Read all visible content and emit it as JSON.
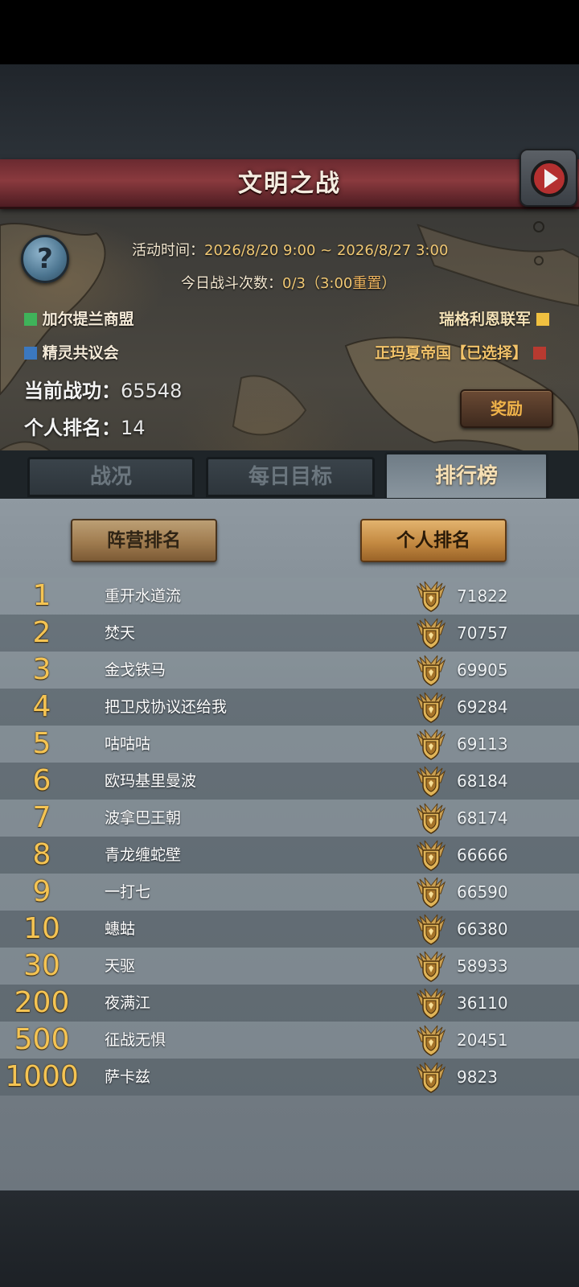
{
  "header": {
    "title": "文明之战"
  },
  "event": {
    "time_label": "活动时间：",
    "time_value": "2026/8/20 9:00 ~ 2026/8/27 3:00",
    "battles_label": "今日战斗次数：",
    "battles_value": "0/3（3:00",
    "battles_reset": "重置",
    "battles_close": "）"
  },
  "factions": {
    "left": [
      {
        "name": "加尔提兰商盟",
        "color": "#3fb35a"
      },
      {
        "name": "精灵共议会",
        "color": "#3b78c0"
      }
    ],
    "right": [
      {
        "name": "瑞格利恩联军",
        "color": "#f0c040"
      },
      {
        "name": "正玛夏帝国【已选择】",
        "color": "#b83a30"
      }
    ]
  },
  "stats": {
    "merit_label": "当前战功：",
    "merit_value": "65548",
    "rank_label": "个人排名：",
    "rank_value": "14"
  },
  "buttons": {
    "reward": "奖励"
  },
  "tabs": [
    "战况",
    "每日目标",
    "排行榜"
  ],
  "subtabs": [
    "阵营排名",
    "个人排名"
  ],
  "icons": {
    "help": "question-icon",
    "video": "play-video-icon",
    "medal": "medal-icon"
  },
  "ranking": [
    {
      "rank": "1",
      "name": "重开水道流",
      "score": "71822"
    },
    {
      "rank": "2",
      "name": "焚天",
      "score": "70757"
    },
    {
      "rank": "3",
      "name": "金戈铁马",
      "score": "69905"
    },
    {
      "rank": "4",
      "name": "把卫戍协议还给我",
      "score": "69284"
    },
    {
      "rank": "5",
      "name": "咕咕咕",
      "score": "69113"
    },
    {
      "rank": "6",
      "name": "欧玛基里曼波",
      "score": "68184"
    },
    {
      "rank": "7",
      "name": "波拿巴王朝",
      "score": "68174"
    },
    {
      "rank": "8",
      "name": "青龙缠蛇壁",
      "score": "66666"
    },
    {
      "rank": "9",
      "name": "一打七",
      "score": "66590"
    },
    {
      "rank": "10",
      "name": "蟪蛄",
      "score": "66380"
    },
    {
      "rank": "30",
      "name": "天驱",
      "score": "58933"
    },
    {
      "rank": "200",
      "name": "夜满江",
      "score": "36110"
    },
    {
      "rank": "500",
      "name": "征战无惧",
      "score": "20451"
    },
    {
      "rank": "1000",
      "name": "萨卡兹",
      "score": "9823"
    }
  ]
}
